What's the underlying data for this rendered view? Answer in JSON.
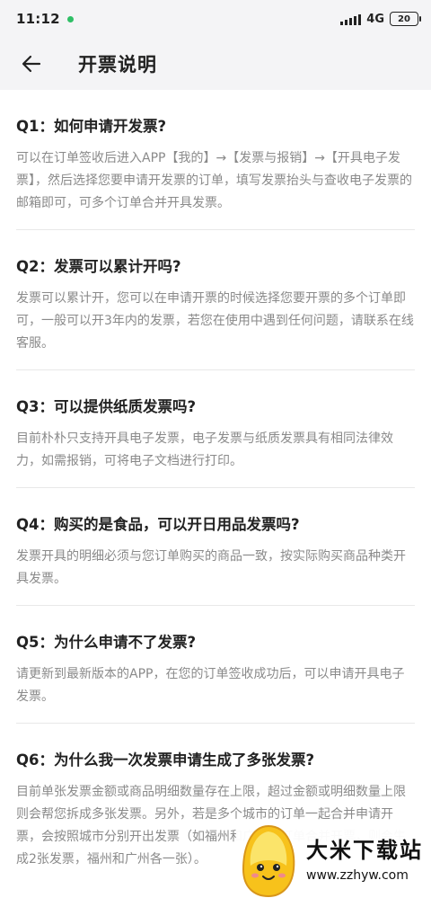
{
  "status_bar": {
    "time": "11:12",
    "network": "4G",
    "battery": "20"
  },
  "header": {
    "title": "开票说明"
  },
  "faq": [
    {
      "q": "Q1：如何申请开发票?",
      "a": "可以在订单签收后进入APP【我的】→【发票与报销】→【开具电子发票】，然后选择您要申请开发票的订单，填写发票抬头与查收电子发票的邮箱即可，可多个订单合并开具发票。"
    },
    {
      "q": "Q2：发票可以累计开吗?",
      "a": "发票可以累计开，您可以在申请开票的时候选择您要开票的多个订单即可，一般可以开3年内的发票，若您在使用中遇到任何问题，请联系在线客服。"
    },
    {
      "q": "Q3：可以提供纸质发票吗?",
      "a": "目前朴朴只支持开具电子发票，电子发票与纸质发票具有相同法律效力，如需报销，可将电子文档进行打印。"
    },
    {
      "q": "Q4：购买的是食品，可以开日用品发票吗?",
      "a": "发票开具的明细必须与您订单购买的商品一致，按实际购买商品种类开具发票。"
    },
    {
      "q": "Q5：为什么申请不了发票?",
      "a": "请更新到最新版本的APP，在您的订单签收成功后，可以申请开具电子发票。"
    },
    {
      "q": "Q6：为什么我一次发票申请生成了多张发票?",
      "a": "目前单张发票金额或商品明细数量存在上限，超过金额或明细数量上限则会帮您拆成多张发票。另外，若是多个城市的订单一起合并申请开票，会按照城市分别开出发票（如福州和广州的订单合并开票，则会生成2张发票，福州和广州各一张）。"
    }
  ],
  "watermark": {
    "name": "大米下载站",
    "url": "www.zzhyw.com"
  },
  "colors": {
    "header_bg": "#f4f4f6",
    "question": "#222222",
    "answer": "#8a8a8a",
    "divider": "#e8e8e8"
  }
}
